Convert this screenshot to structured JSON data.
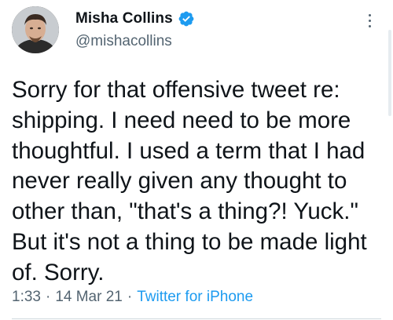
{
  "author": {
    "name": "Misha Collins",
    "handle": "@mishacollins",
    "verified": true,
    "avatar_icon": "profile-photo"
  },
  "tweet": {
    "lines": [
      "Sorry for that offensive tweet re:",
      "shipping. I need need to be more",
      "thoughtful. I used a term that I had",
      "never really given any thought to",
      "other than, \"that's a thing?! Yuck.\"",
      "But it's not a thing to be made light",
      "of. Sorry."
    ]
  },
  "meta": {
    "time": "1:33",
    "separator": "·",
    "date": "14 Mar 21",
    "source": "Twitter for iPhone"
  },
  "colors": {
    "text": "#0f1419",
    "secondary": "#536471",
    "accent": "#1d9bf0"
  },
  "icons": {
    "verified": "verified-badge-icon",
    "more": "more-options-icon"
  }
}
